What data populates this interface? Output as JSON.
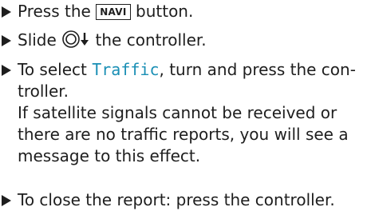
{
  "steps": [
    {
      "before": "Press the",
      "key": "NAVI",
      "after": "button."
    },
    {
      "before": "Slide",
      "icon": "controller-slide-down-icon",
      "after": "the controller."
    },
    {
      "before": "To select",
      "highlight": "Traffic",
      "after": ", turn and press the con-",
      "cont": "troller.",
      "note": [
        "If satellite signals cannot be received or",
        "there are no traffic reports, you will see a",
        "message to this effect."
      ]
    },
    {
      "text": "To close the report: press the controller."
    }
  ],
  "colors": {
    "text": "#1e1e1e",
    "highlight": "#1a8fb5"
  }
}
